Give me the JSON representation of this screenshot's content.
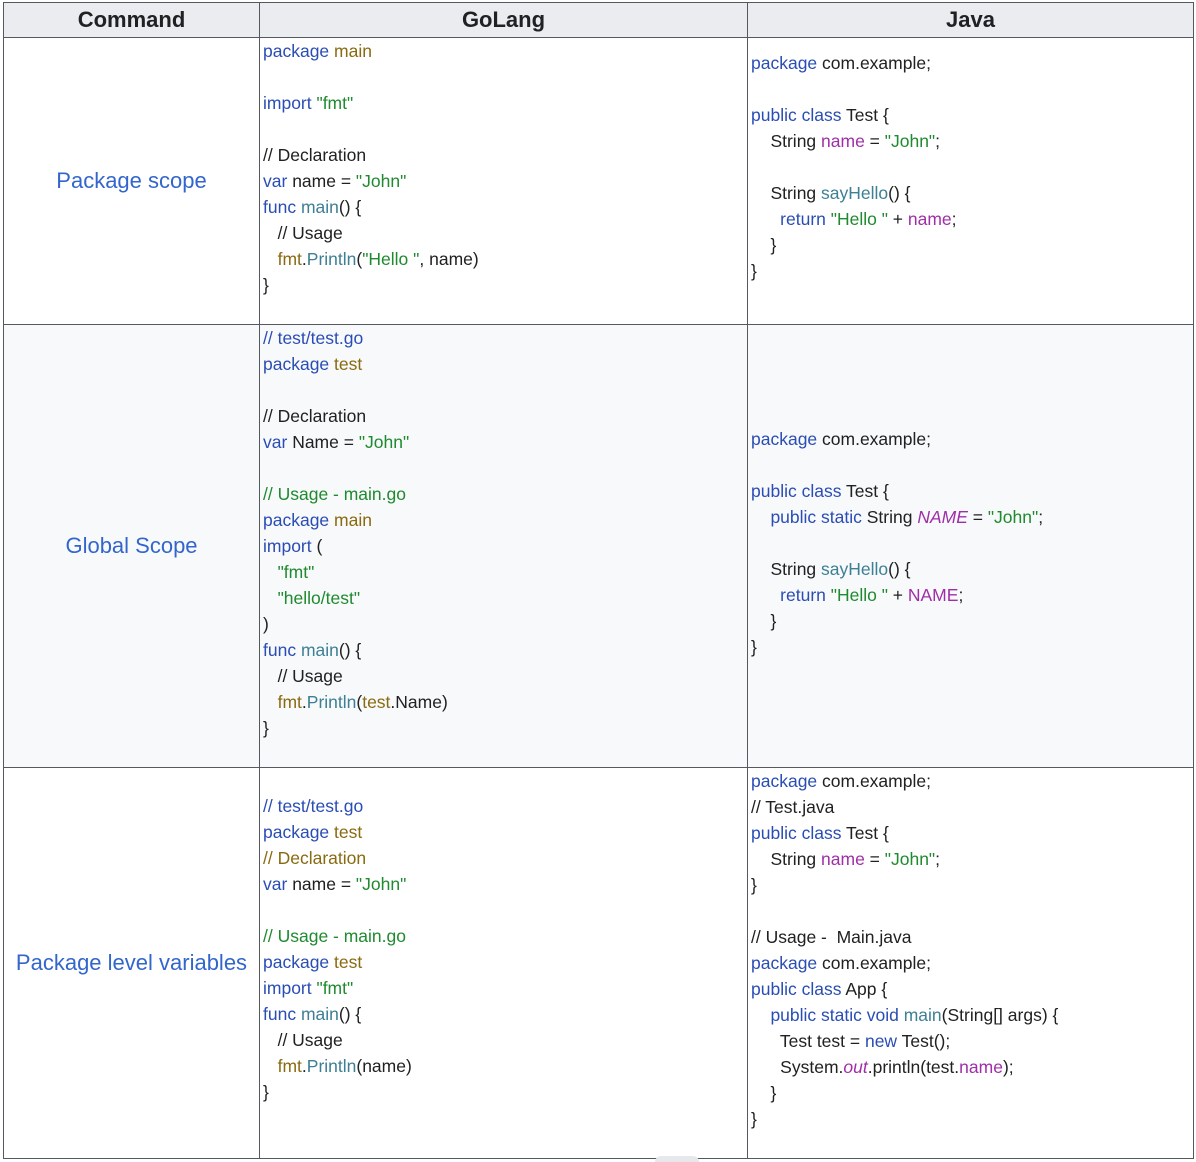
{
  "table": {
    "headers": [
      "Command",
      "GoLang",
      "Java"
    ],
    "rows": [
      {
        "label": "Package scope",
        "go": [
          [
            [
              "k",
              "package "
            ],
            [
              "pk",
              "main"
            ]
          ],
          [],
          [
            [
              "k",
              "import "
            ],
            [
              "s",
              "\"fmt\""
            ]
          ],
          [],
          [
            [
              "p",
              "// Declaration"
            ]
          ],
          [
            [
              "k",
              "var "
            ],
            [
              "p",
              "name = "
            ],
            [
              "s",
              "\"John\""
            ]
          ],
          [
            [
              "k",
              "func "
            ],
            [
              "f",
              "main"
            ],
            [
              "p",
              "() {"
            ]
          ],
          [
            [
              "p",
              "   // Usage"
            ]
          ],
          [
            [
              "pk",
              "   fmt"
            ],
            [
              "p",
              "."
            ],
            [
              "f",
              "Println"
            ],
            [
              "p",
              "("
            ],
            [
              "s",
              "\"Hello \""
            ],
            [
              "p",
              ", name)"
            ]
          ],
          [
            [
              "p",
              "}"
            ]
          ]
        ],
        "java": [
          [
            [
              "k",
              "package "
            ],
            [
              "p",
              "com.example;"
            ]
          ],
          [],
          [
            [
              "k",
              "public class "
            ],
            [
              "p",
              "Test {"
            ]
          ],
          [
            [
              "p",
              "    String "
            ],
            [
              "v",
              "name"
            ],
            [
              "p",
              " = "
            ],
            [
              "s",
              "\"John\""
            ],
            [
              "p",
              ";"
            ]
          ],
          [],
          [
            [
              "p",
              "    String "
            ],
            [
              "f",
              "sayHello"
            ],
            [
              "p",
              "() {"
            ]
          ],
          [
            [
              "k",
              "      return "
            ],
            [
              "s",
              "\"Hello \""
            ],
            [
              "p",
              " + "
            ],
            [
              "v",
              "name"
            ],
            [
              "p",
              ";"
            ]
          ],
          [
            [
              "p",
              "    }"
            ]
          ],
          [
            [
              "p",
              "}"
            ]
          ]
        ]
      },
      {
        "label": "Global Scope",
        "go": [
          [
            [
              "cb",
              "// test/test.go"
            ]
          ],
          [
            [
              "k",
              "package "
            ],
            [
              "pk",
              "test"
            ]
          ],
          [],
          [
            [
              "p",
              "// Declaration"
            ]
          ],
          [
            [
              "k",
              "var "
            ],
            [
              "p",
              "Name = "
            ],
            [
              "s",
              "\"John\""
            ]
          ],
          [],
          [
            [
              "cg",
              "// Usage - main.go"
            ]
          ],
          [
            [
              "k",
              "package "
            ],
            [
              "pk",
              "main"
            ]
          ],
          [
            [
              "k",
              "import "
            ],
            [
              "p",
              "("
            ]
          ],
          [
            [
              "s",
              "   \"fmt\""
            ]
          ],
          [
            [
              "s",
              "   \"hello/test\""
            ]
          ],
          [
            [
              "p",
              ")"
            ]
          ],
          [
            [
              "k",
              "func "
            ],
            [
              "f",
              "main"
            ],
            [
              "p",
              "() {"
            ]
          ],
          [
            [
              "p",
              "   // Usage"
            ]
          ],
          [
            [
              "pk",
              "   fmt"
            ],
            [
              "p",
              "."
            ],
            [
              "f",
              "Println"
            ],
            [
              "p",
              "("
            ],
            [
              "pk",
              "test"
            ],
            [
              "p",
              ".Name)"
            ]
          ],
          [
            [
              "p",
              "}"
            ]
          ]
        ],
        "java": [
          [
            [
              "k",
              "package "
            ],
            [
              "p",
              "com.example;"
            ]
          ],
          [],
          [
            [
              "k",
              "public class "
            ],
            [
              "p",
              "Test {"
            ]
          ],
          [
            [
              "k",
              "    public static "
            ],
            [
              "p",
              "String "
            ],
            [
              "vi",
              "NAME"
            ],
            [
              "p",
              " = "
            ],
            [
              "s",
              "\"John\""
            ],
            [
              "p",
              ";"
            ]
          ],
          [],
          [
            [
              "p",
              "    String "
            ],
            [
              "f",
              "sayHello"
            ],
            [
              "p",
              "() {"
            ]
          ],
          [
            [
              "k",
              "      return "
            ],
            [
              "s",
              "\"Hello \""
            ],
            [
              "p",
              " + "
            ],
            [
              "v",
              "NAME"
            ],
            [
              "p",
              ";"
            ]
          ],
          [
            [
              "p",
              "    }"
            ]
          ],
          [
            [
              "p",
              "}"
            ]
          ]
        ]
      },
      {
        "label": "Package level variables",
        "go": [
          [
            [
              "cb",
              "// test/test.go"
            ]
          ],
          [
            [
              "k",
              "package "
            ],
            [
              "pk",
              "test"
            ]
          ],
          [
            [
              "cy",
              "// Declaration"
            ]
          ],
          [
            [
              "k",
              "var "
            ],
            [
              "p",
              "name = "
            ],
            [
              "s",
              "\"John\""
            ]
          ],
          [],
          [
            [
              "cg",
              "// Usage - main.go"
            ]
          ],
          [
            [
              "k",
              "package "
            ],
            [
              "pk",
              "test"
            ]
          ],
          [
            [
              "k",
              "import "
            ],
            [
              "s",
              "\"fmt\""
            ]
          ],
          [
            [
              "k",
              "func "
            ],
            [
              "f",
              "main"
            ],
            [
              "p",
              "() {"
            ]
          ],
          [
            [
              "p",
              "   // Usage"
            ]
          ],
          [
            [
              "pk",
              "   fmt"
            ],
            [
              "p",
              "."
            ],
            [
              "f",
              "Println"
            ],
            [
              "p",
              "(name)"
            ]
          ],
          [
            [
              "p",
              "}"
            ]
          ]
        ],
        "java": [
          [
            [
              "k",
              "package "
            ],
            [
              "p",
              "com.example;"
            ]
          ],
          [
            [
              "p",
              "// Test.java"
            ]
          ],
          [
            [
              "k",
              "public class "
            ],
            [
              "p",
              "Test {"
            ]
          ],
          [
            [
              "p",
              "    String "
            ],
            [
              "v",
              "name"
            ],
            [
              "p",
              " = "
            ],
            [
              "s",
              "\"John\""
            ],
            [
              "p",
              ";"
            ]
          ],
          [
            [
              "p",
              "}"
            ]
          ],
          [],
          [
            [
              "p",
              "// Usage -  Main.java"
            ]
          ],
          [
            [
              "k",
              "package "
            ],
            [
              "p",
              "com.example;"
            ]
          ],
          [
            [
              "k",
              "public class "
            ],
            [
              "p",
              "App {"
            ]
          ],
          [
            [
              "k",
              "    public static void "
            ],
            [
              "f",
              "main"
            ],
            [
              "p",
              "(String[] args) {"
            ]
          ],
          [
            [
              "p",
              "      Test test = "
            ],
            [
              "k",
              "new "
            ],
            [
              "p",
              "Test();"
            ]
          ],
          [
            [
              "p",
              "      System."
            ],
            [
              "vi",
              "out"
            ],
            [
              "p",
              ".println(test."
            ],
            [
              "v",
              "name"
            ],
            [
              "p",
              ");"
            ]
          ],
          [
            [
              "p",
              "    }"
            ]
          ],
          [
            [
              "p",
              "}"
            ]
          ]
        ]
      }
    ]
  }
}
